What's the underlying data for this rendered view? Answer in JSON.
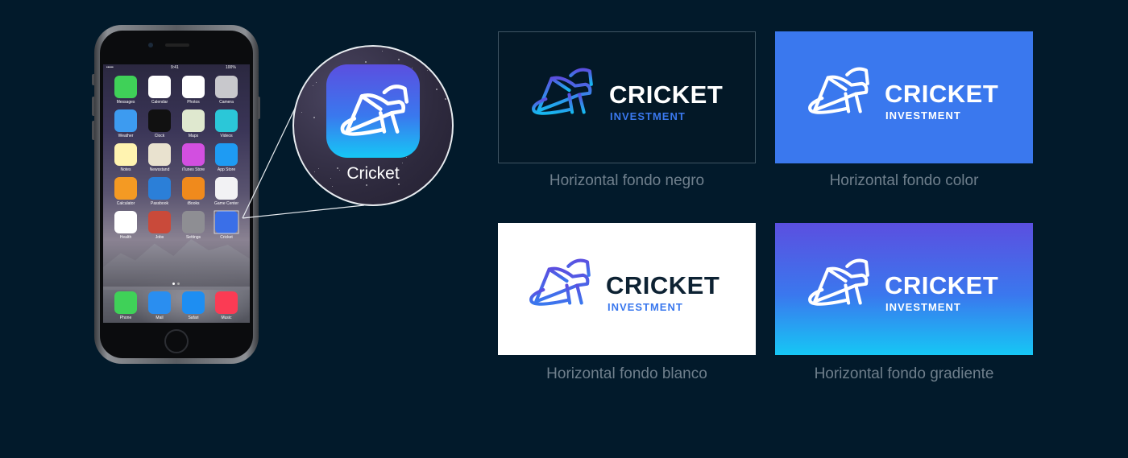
{
  "phone": {
    "status": {
      "carrier": "•••••",
      "time": "9:41",
      "battery": "100%"
    },
    "rows": [
      [
        {
          "label": "Messages",
          "color": "#3fd158",
          "icon": "message-icon"
        },
        {
          "label": "Calendar",
          "color": "#ffffff",
          "icon": "calendar-icon"
        },
        {
          "label": "Photos",
          "color": "#ffffff",
          "icon": "photos-icon"
        },
        {
          "label": "Camera",
          "color": "#c8c8cc",
          "icon": "camera-icon"
        }
      ],
      [
        {
          "label": "Weather",
          "color": "#3d9bf0",
          "icon": "weather-icon"
        },
        {
          "label": "Clock",
          "color": "#111111",
          "icon": "clock-icon"
        },
        {
          "label": "Maps",
          "color": "#dfe8cf",
          "icon": "maps-icon"
        },
        {
          "label": "Videos",
          "color": "#2bc7d8",
          "icon": "videos-icon"
        }
      ],
      [
        {
          "label": "Notes",
          "color": "#fff3b0",
          "icon": "notes-icon"
        },
        {
          "label": "Newsstand",
          "color": "#e9e2cf",
          "icon": "newsstand-icon"
        },
        {
          "label": "iTunes Store",
          "color": "#d24fe0",
          "icon": "music-note-icon"
        },
        {
          "label": "App Store",
          "color": "#1e9bf3",
          "icon": "app-store-icon"
        }
      ],
      [
        {
          "label": "Calculator",
          "color": "#f49a23",
          "icon": "calculator-icon"
        },
        {
          "label": "Passbook",
          "color": "#2b7fd8",
          "icon": "passbook-icon"
        },
        {
          "label": "iBooks",
          "color": "#f08a1c",
          "icon": "books-icon"
        },
        {
          "label": "Game Center",
          "color": "#f2f2f4",
          "icon": "game-center-icon"
        }
      ],
      [
        {
          "label": "Health",
          "color": "#ffffff",
          "icon": "heart-icon"
        },
        {
          "label": "Jobs",
          "color": "#c94a3a",
          "icon": "jobs-icon"
        },
        {
          "label": "Settings",
          "color": "#8e8e93",
          "icon": "gear-icon"
        },
        {
          "label": "Cricket",
          "color": "#3a6fe8",
          "icon": "cricket-logo-icon"
        }
      ]
    ],
    "dock": [
      {
        "label": "Phone",
        "color": "#3fd158",
        "icon": "phone-icon"
      },
      {
        "label": "Mail",
        "color": "#2a8ef0",
        "icon": "mail-icon"
      },
      {
        "label": "Safari",
        "color": "#1e8ef2",
        "icon": "compass-icon"
      },
      {
        "label": "Music",
        "color": "#fb3b54",
        "icon": "music-note-icon"
      }
    ]
  },
  "zoom": {
    "label": "Cricket"
  },
  "brand": {
    "name": "CRICKET",
    "tagline": "INVESTMENT"
  },
  "cards": [
    {
      "caption": "Horizontal fondo negro"
    },
    {
      "caption": "Horizontal fondo color"
    },
    {
      "caption": "Horizontal fondo blanco"
    },
    {
      "caption": "Horizontal fondo gradiente"
    }
  ],
  "colors": {
    "background": "#021a2b",
    "brand_blue": "#3a78ee",
    "brand_purple": "#5b4fe0",
    "brand_cyan": "#16c7f5",
    "caption": "#6f7f8c"
  }
}
